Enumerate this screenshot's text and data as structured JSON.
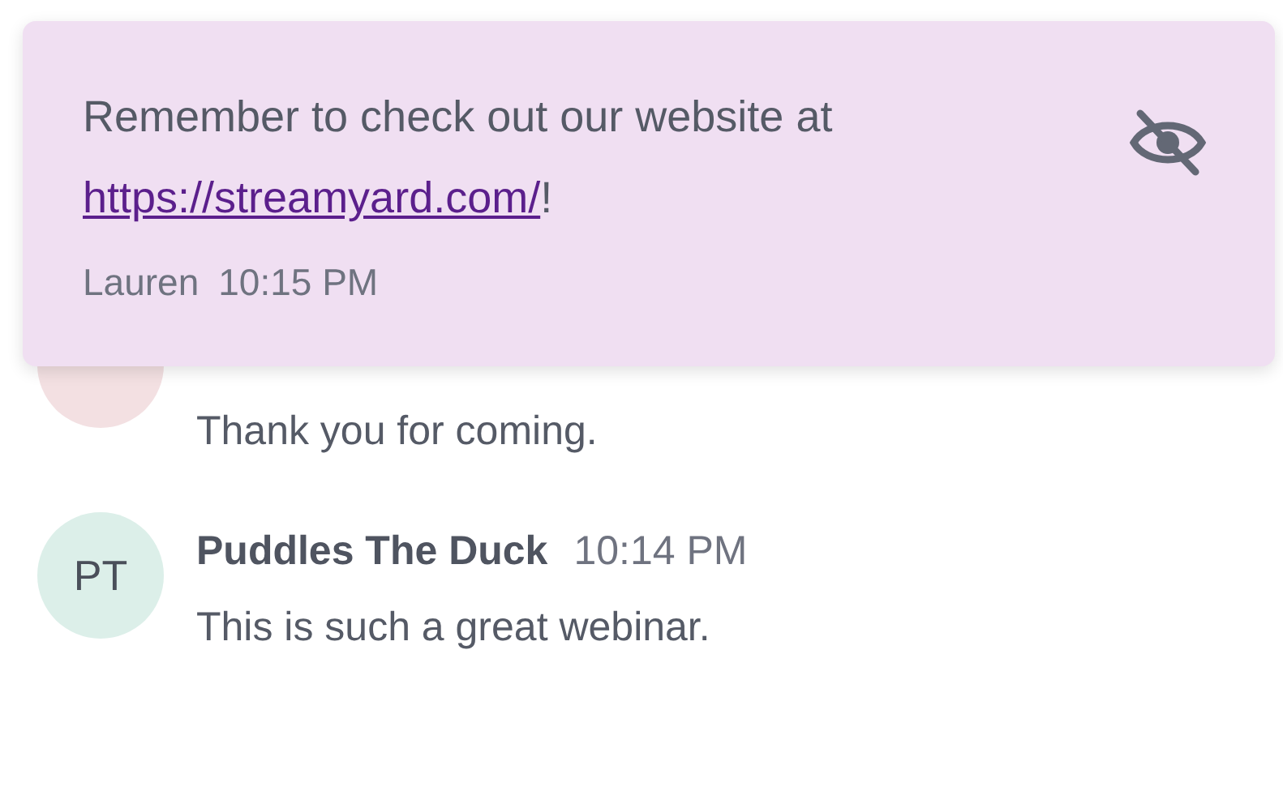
{
  "pinned_message": {
    "text": "Remember to check out our website at",
    "link": "https://streamyard.com/",
    "suffix": "!",
    "author": "Lauren",
    "time": "10:15 PM"
  },
  "messages": [
    {
      "color": "#f3e0e2",
      "body": "Thank you for coming."
    },
    {
      "initials": "PT",
      "color": "#dcefe9",
      "author": "Puddles The Duck",
      "time": "10:14 PM",
      "body": "This is such a great webinar."
    }
  ]
}
